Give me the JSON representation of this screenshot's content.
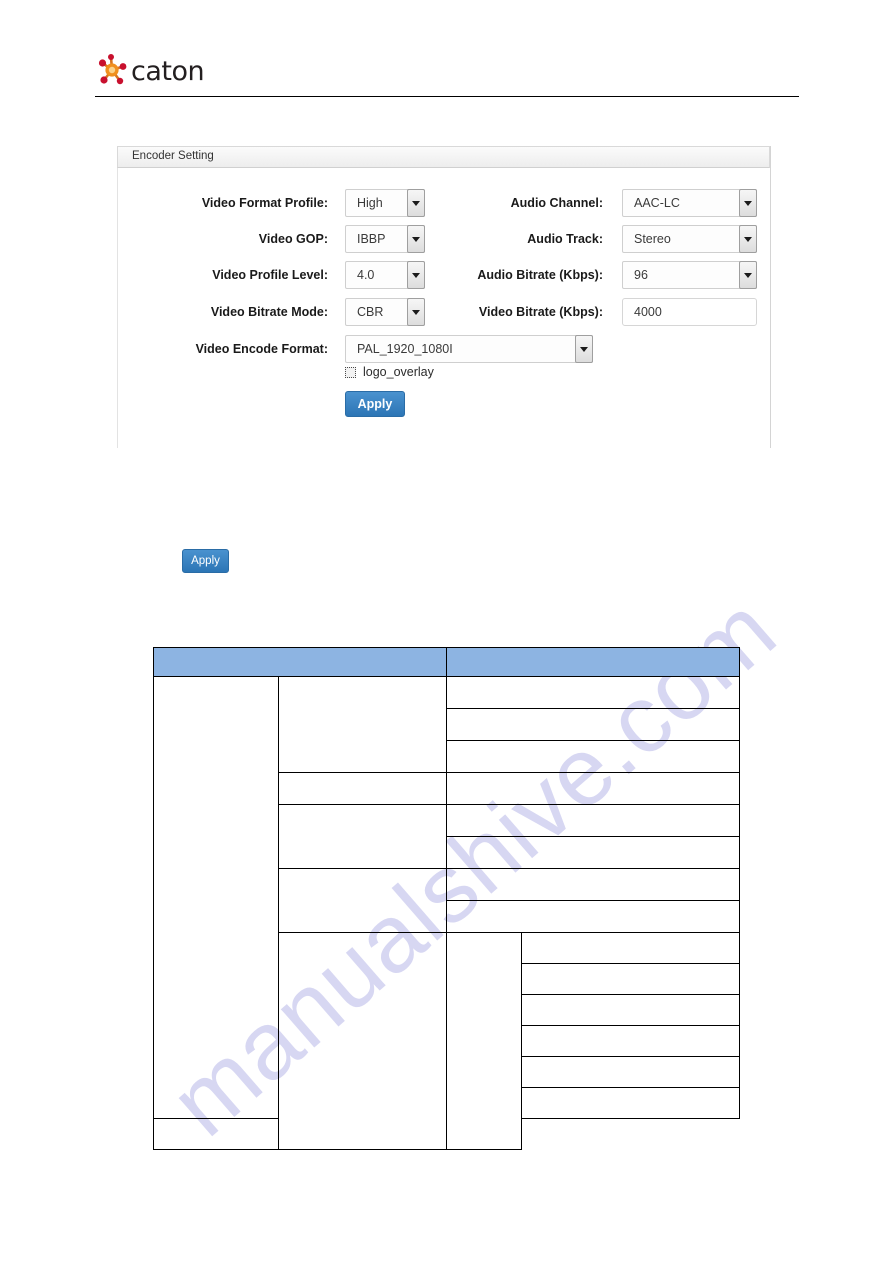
{
  "header": {
    "brand_name": "caton",
    "logo_icon": "caton-molecule-logo",
    "logo_colors": {
      "red": "#c8102e",
      "orange": "#f0901e",
      "amber": "#e8a020"
    }
  },
  "watermark": {
    "text": "manualshive.com",
    "color": "#c9c9ee"
  },
  "panel": {
    "title": "Encoder Setting",
    "fields_left": [
      {
        "label": "Video Format Profile:",
        "value": "High",
        "control": "select"
      },
      {
        "label": "Video GOP:",
        "value": "IBBP",
        "control": "select"
      },
      {
        "label": "Video Profile Level:",
        "value": "4.0",
        "control": "select"
      },
      {
        "label": "Video Bitrate Mode:",
        "value": "CBR",
        "control": "select"
      },
      {
        "label": "Video Encode Format:",
        "value": "PAL_1920_1080I",
        "control": "select"
      }
    ],
    "fields_right": [
      {
        "label": "Audio Channel:",
        "value": "AAC-LC",
        "control": "select"
      },
      {
        "label": "Audio Track:",
        "value": "Stereo",
        "control": "select"
      },
      {
        "label": "Audio Bitrate (Kbps):",
        "value": "96",
        "control": "select"
      },
      {
        "label": "Video Bitrate (Kbps):",
        "value": "4000",
        "control": "text"
      }
    ],
    "overlay": {
      "checkbox_icon": "checkbox-unchecked",
      "label": "logo_overlay",
      "checked": false
    },
    "apply_label": "Apply"
  },
  "standalone_apply": {
    "label": "Apply"
  },
  "spec_table": {
    "header_color": "#8db4e2",
    "headers": [
      "",
      "",
      ""
    ],
    "rows": [
      {
        "cells": [
          "",
          "",
          ""
        ]
      },
      {
        "cells": [
          "",
          "",
          ""
        ]
      },
      {
        "cells": [
          "",
          "",
          ""
        ]
      },
      {
        "cells": [
          "",
          "",
          ""
        ]
      },
      {
        "cells": [
          "",
          "",
          ""
        ]
      },
      {
        "cells": [
          "",
          "",
          ""
        ]
      },
      {
        "cells": [
          "",
          "",
          ""
        ]
      },
      {
        "cells": [
          "",
          "",
          ""
        ]
      },
      {
        "cells": [
          "",
          "",
          ""
        ]
      },
      {
        "cells": [
          "",
          "",
          ""
        ]
      },
      {
        "cells": [
          "",
          "",
          ""
        ]
      },
      {
        "cells": [
          "",
          "",
          ""
        ]
      },
      {
        "cells": [
          "",
          "",
          ""
        ]
      },
      {
        "cells": [
          "",
          "",
          ""
        ]
      }
    ]
  }
}
